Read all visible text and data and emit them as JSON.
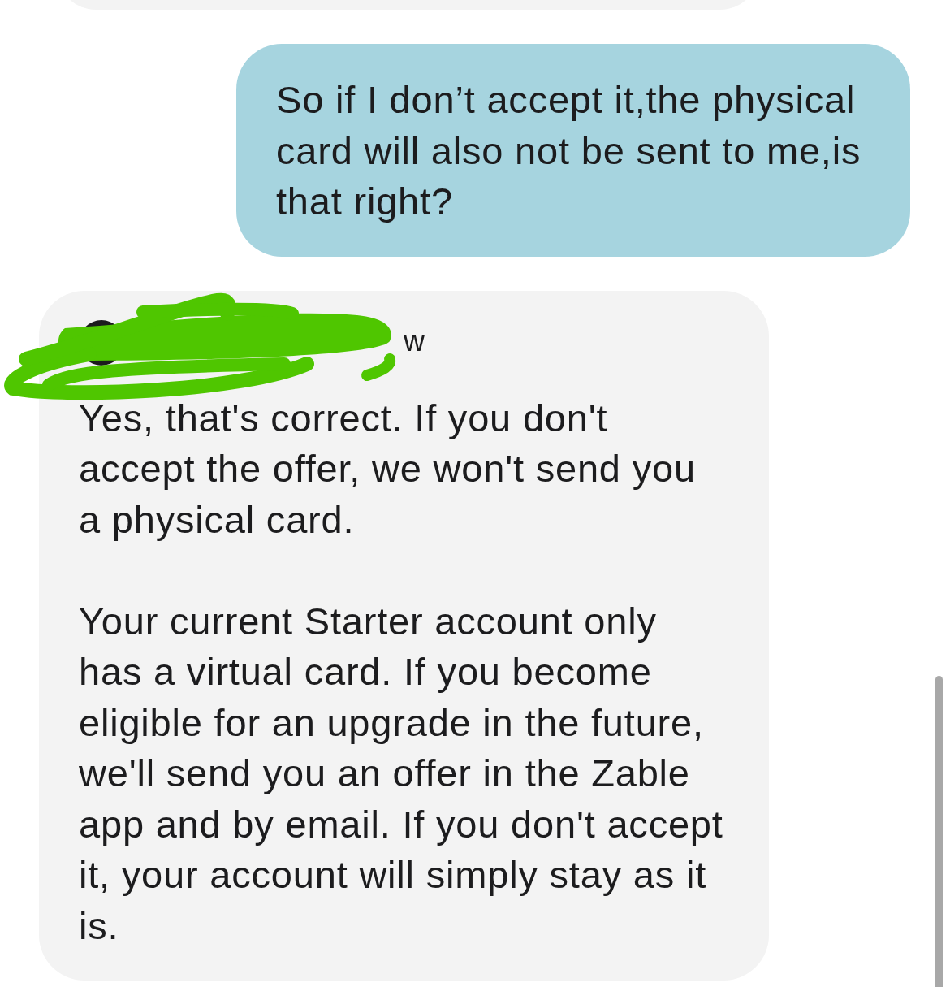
{
  "messages": [
    {
      "kind": "incoming-edge"
    },
    {
      "kind": "outgoing",
      "text": "So if I don’t accept it,the physical card will also not be sent to me,is that right?"
    },
    {
      "kind": "incoming",
      "redacted": true,
      "header": "w",
      "paragraphs": [
        "Yes, that's correct. If you don't accept the offer, we won't send you a physical card.",
        "Your current Starter account only has a virtual card. If you become eligible for an upgrade in the future, we'll send you an offer in the Zable app and by email. If you don't accept it, your account will simply stay as it is."
      ]
    }
  ]
}
